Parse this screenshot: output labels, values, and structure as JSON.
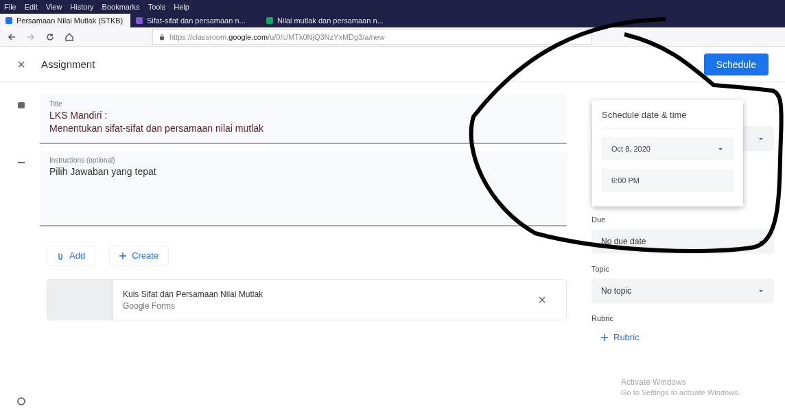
{
  "browser": {
    "menu": [
      "File",
      "Edit",
      "View",
      "History",
      "Bookmarks",
      "Tools",
      "Help"
    ],
    "tabs": [
      {
        "label": "Persamaan Nilai Mutlak (STKB)",
        "selected": true
      },
      {
        "label": "Sifat-sifat dan persamaan n...",
        "selected": false
      },
      {
        "label": "Nilai mutlak dan persamaan n...",
        "selected": false
      }
    ],
    "url": {
      "prefix": "https://classroom.",
      "domain": "google.com",
      "path": "/u/0/c/MTk0NjQ3NzYxMDg3/a/new"
    }
  },
  "header": {
    "title": "Assignment",
    "action": "Schedule"
  },
  "form": {
    "title": {
      "label": "Title",
      "lines": [
        "LKS Mandiri :",
        "Menentukan sifat-sifat dan persamaan nilai mutlak"
      ]
    },
    "instructions": {
      "label": "Instructions (optional)",
      "value": "Pilih Jawaban yang tepat"
    },
    "buttons": [
      {
        "label": "Add",
        "kind": "attach"
      },
      {
        "label": "Create",
        "kind": "create"
      }
    ],
    "attachment": {
      "title": "Kuis Sifat dan Persamaan Nilai Mutlak",
      "type": "Google Forms"
    }
  },
  "schedule_popup": {
    "title": "Schedule date & time",
    "date": "Oct 8, 2020",
    "time": "6:00 PM"
  },
  "sidebar": {
    "fields": [
      {
        "label": "Due",
        "value": "No due date"
      },
      {
        "label": "Topic",
        "value": "No topic"
      }
    ],
    "rubric": {
      "label": "Rubric",
      "button": "Rubric"
    }
  },
  "os_notice": {
    "title": "Activate Windows",
    "subtitle": "Go to Settings to activate Windows."
  }
}
